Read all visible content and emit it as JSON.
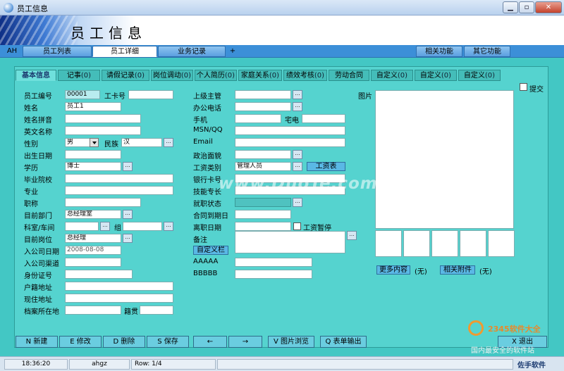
{
  "window": {
    "title": "员工信息",
    "min_symbol": "▁",
    "max_symbol": "▫",
    "close_symbol": "✕"
  },
  "banner": {
    "heading": "员工信息"
  },
  "nav": {
    "tabs": [
      {
        "label": "AH"
      },
      {
        "label": "员工列表"
      },
      {
        "label": "员工详细"
      },
      {
        "label": "业务记录"
      },
      {
        "label": "+"
      },
      {
        "label": "相关功能"
      },
      {
        "label": "其它功能"
      }
    ]
  },
  "subtabs": [
    {
      "label": "基本信息",
      "count": ""
    },
    {
      "label": "记事",
      "count": "(0)"
    },
    {
      "label": "请假记录",
      "count": "(0)"
    },
    {
      "label": "岗位调动",
      "count": "(0)"
    },
    {
      "label": "个人简历",
      "count": "(0)"
    },
    {
      "label": "家庭关系",
      "count": "(0)"
    },
    {
      "label": "绩效考核",
      "count": "(0)"
    },
    {
      "label": "劳动合同",
      "count": ""
    },
    {
      "label": "自定义",
      "count": "(0)"
    },
    {
      "label": "自定义",
      "count": "(0)"
    },
    {
      "label": "自定义",
      "count": "(0)"
    }
  ],
  "form_left": {
    "emp_no_label": "员工编号",
    "emp_no": "00001",
    "card_label": "工卡号",
    "card": "",
    "name_label": "姓名",
    "name": "员工1",
    "pinyin_label": "姓名拼音",
    "pinyin": "",
    "en_label": "英文名称",
    "en": "",
    "gender_label": "性别",
    "gender": "男",
    "ethnic_label": "民族",
    "ethnic": "汉",
    "birth_label": "出生日期",
    "birth": "",
    "edu_label": "学历",
    "edu": "博士",
    "school_label": "毕业院校",
    "school": "",
    "major_label": "专业",
    "major": "",
    "title_label": "职称",
    "title_val": "",
    "dept_label": "目前部门",
    "dept": "总经理室",
    "section_label": "科室/车间",
    "section": "",
    "group_label": "组",
    "group": "",
    "post_label": "目前岗位",
    "post": "总经理",
    "join_label": "入公司日期",
    "join": "2008-08-08",
    "channel_label": "入公司渠道",
    "channel": "",
    "id_label": "身份证号",
    "id": "",
    "hukou_label": "户籍地址",
    "hukou": "",
    "addr_label": "现住地址",
    "addr": "",
    "archive_label": "档案所在地",
    "archive": "",
    "origin_label": "籍贯",
    "origin": ""
  },
  "form_mid": {
    "boss_label": "上级主管",
    "boss": "",
    "office_label": "办公电话",
    "office": "",
    "mobile_label": "手机",
    "mobile": "",
    "home_label": "宅电",
    "home": "",
    "msn_label": "MSN/QQ",
    "msn": "",
    "email_label": "Email",
    "email": "",
    "politics_label": "政治面貌",
    "politics": "",
    "paytype_label": "工资类别",
    "paytype": "管理人员",
    "paytable_btn": "工资表",
    "bank_label": "银行卡号",
    "bank": "",
    "skill_label": "技能专长",
    "skill": "",
    "status_label": "就职状态",
    "status": "",
    "contract_label": "合同到期日",
    "contract": "",
    "leave_label": "离职日期",
    "leave": "",
    "paystop_label": "工资暂停",
    "note_label": "备注",
    "note": "",
    "custom_btn": "自定义栏",
    "a_label": "AAAAA",
    "a": "",
    "b_label": "BBBBB",
    "b": ""
  },
  "photo": {
    "label": "图片",
    "submit_label": "提交",
    "more_btn": "更多内容",
    "more_val": "(无)",
    "attach_btn": "相关附件",
    "attach_val": "(无)"
  },
  "actions": {
    "new": "N 新建",
    "edit": "E 修改",
    "delete": "D 删除",
    "save": "S 保存",
    "prev": "←",
    "next": "→",
    "image_browse": "V 图片浏览",
    "export": "Q 表单输出",
    "exit": "X 退出"
  },
  "statusbar": {
    "time": "18:36:20",
    "user": "ahgz",
    "row": "Row: 1/4"
  },
  "overlay": {
    "watermark": "www.DuoTe.com",
    "brand1": "2345软件大全",
    "brand2": "国内最安全的软件站",
    "brand3": "佐手软件"
  }
}
